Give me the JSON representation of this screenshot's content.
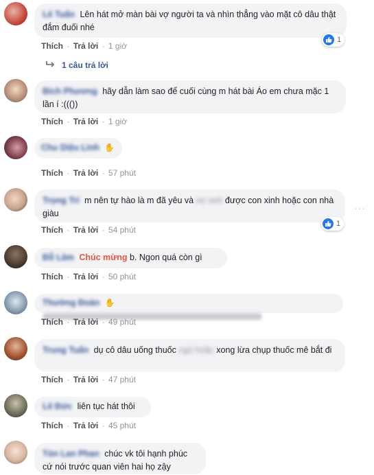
{
  "actions": {
    "like": "Thích",
    "reply": "Trả lời",
    "sep": "·"
  },
  "comments": [
    {
      "name": "Lê Tuấn",
      "text": "Lên hát mở màn bài vợ người ta và nhìn thẳng vào mặt cô dâu thật đắm đuối nhé",
      "time": "1 giờ",
      "reactions": "1",
      "avatar_color": "#c0392b"
    },
    {
      "name": "Bích Phương",
      "text": "hãy dẫn làm sao để cuối cùng m hát bài Áo em chưa mặc 1 lần í :((())",
      "time": "1 giờ",
      "avatar_color": "#b58d74"
    },
    {
      "name": "Chu Diệu Linh",
      "time": "57 phút",
      "avatar_color": "#7a3d4a"
    },
    {
      "name": "Trọng Trí",
      "text_before": "m nên tự hào là m đã yêu và",
      "text_hidden": "vợ anh",
      "text_after": "được con xinh hoặc con nhà giàu",
      "time": "54 phút",
      "reactions": "1",
      "avatar_color": "#c9a48f"
    },
    {
      "name": "Đỗ Lâm",
      "highlight": "Chúc mừng",
      "text": "b. Ngon quá còn gì",
      "time": "50 phút",
      "avatar_color": "#4a3b2f"
    },
    {
      "name": "Thường Đoàn",
      "time": "49 phút",
      "avatar_color": "#8aa0b5"
    },
    {
      "name": "Trung Tuấn",
      "text_before": "dụ cô dâu uống thuốc",
      "text_hidden": "ngủ hoặc",
      "text_after": "xong lừa chụp thuốc mê bắt đi",
      "time": "47 phút",
      "avatar_color": "#a0522d"
    },
    {
      "name": "Lê Đức",
      "text": "liên tục hát thôi",
      "time": "45 phút",
      "avatar_color": "#6d6a58"
    },
    {
      "name": "Tòn Lan Phan",
      "text": "chúc vk tôi hạnh phúc cứ nói trước quan viên hai họ zậy",
      "avatar_color": "#d9b6a3"
    }
  ],
  "replies_link": "1 câu trả lời"
}
